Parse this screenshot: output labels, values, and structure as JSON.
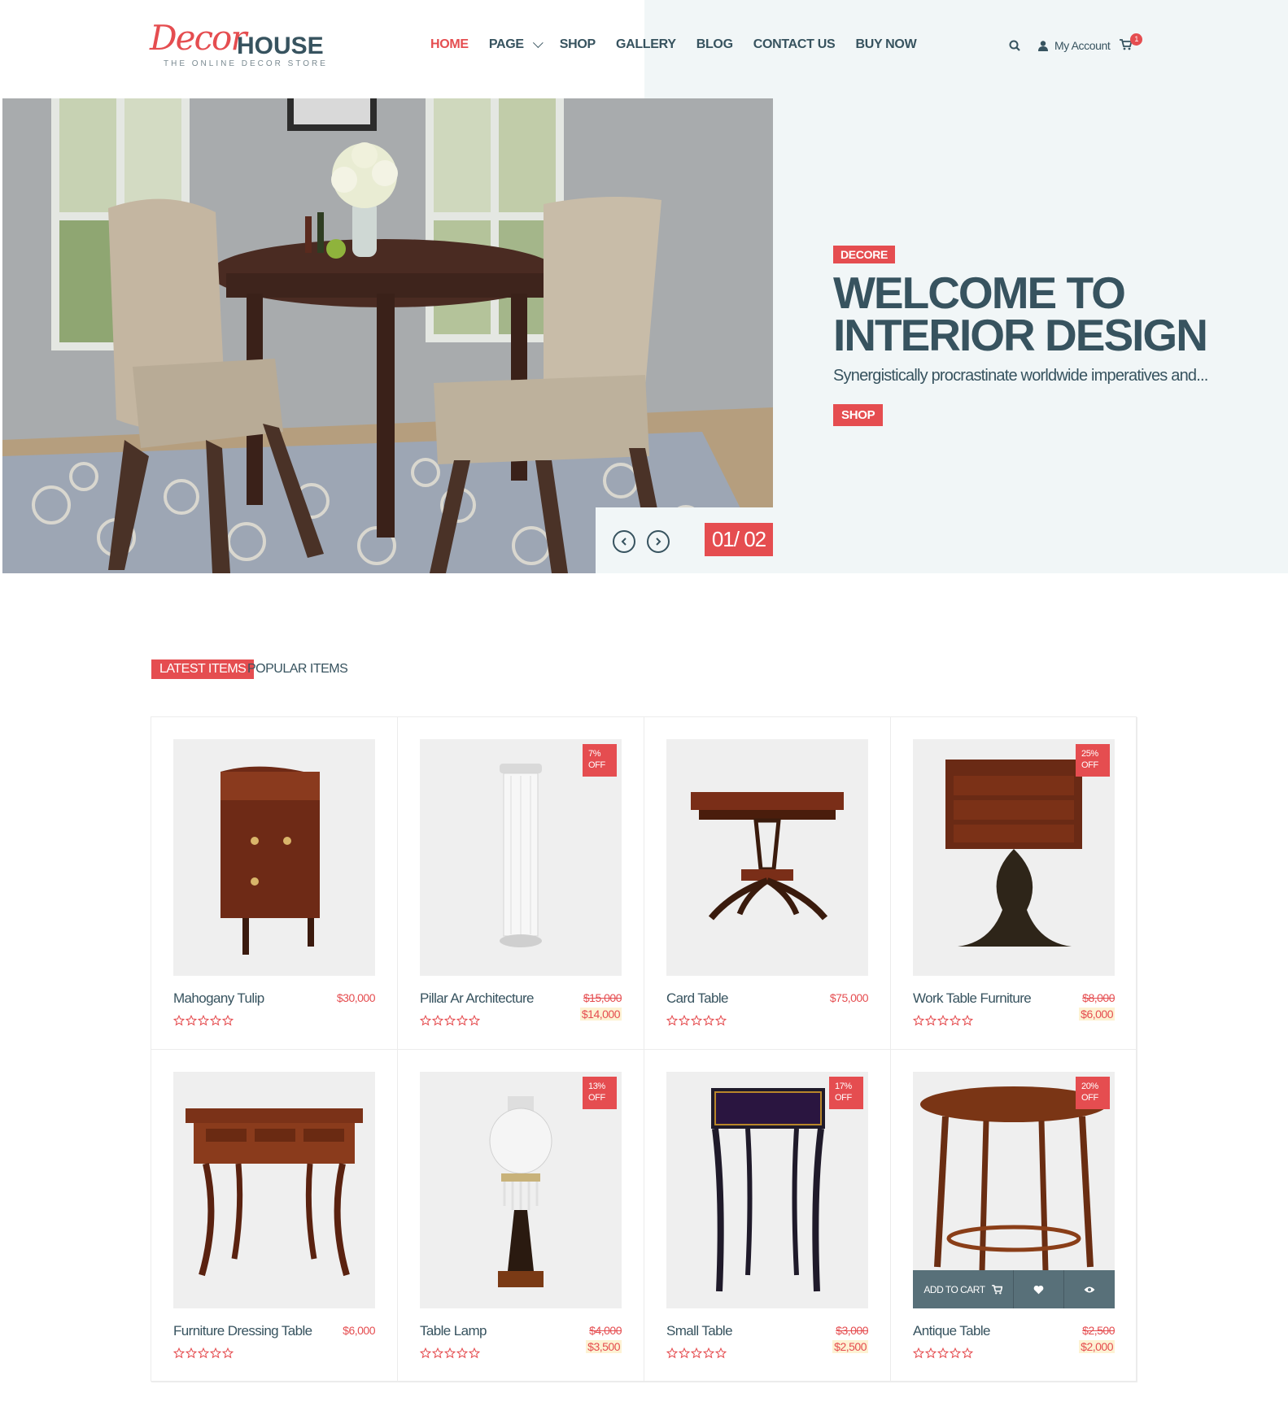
{
  "brand": {
    "logo_script": "Decor",
    "logo_main": "HOUSE",
    "tagline": "THE ONLINE DECOR STORE"
  },
  "nav": [
    {
      "label": "HOME",
      "active": true
    },
    {
      "label": "PAGE",
      "dropdown": true
    },
    {
      "label": "SHOP"
    },
    {
      "label": "GALLERY"
    },
    {
      "label": "BLOG"
    },
    {
      "label": "CONTACT US"
    },
    {
      "label": "BUY NOW"
    }
  ],
  "header_tools": {
    "account_label": "My Account",
    "cart_count": "1",
    "icons": [
      "search-icon",
      "user-icon",
      "cart-icon"
    ]
  },
  "hero": {
    "tag": "DECORE",
    "title": "WELCOME TO INTERIOR DESIGN",
    "subtitle": "Synergistically procrastinate worldwide imperatives and...",
    "button": "SHOP",
    "counter": "01/ 02"
  },
  "tabs": [
    {
      "label": "LATEST ITEMS",
      "active": true
    },
    {
      "label": "POPULAR ITEMS",
      "active": false
    }
  ],
  "products": [
    {
      "name": "Mahogany Tulip",
      "price": "$30,000",
      "old_price": null,
      "badge": null
    },
    {
      "name": "Pillar Ar Architecture",
      "price": "$14,000",
      "old_price": "$15,000",
      "badge": [
        "7%",
        "OFF"
      ]
    },
    {
      "name": "Card Table",
      "price": "$75,000",
      "old_price": null,
      "badge": null
    },
    {
      "name": "Work Table Furniture",
      "price": "$6,000",
      "old_price": "$8,000",
      "badge": [
        "25%",
        "OFF"
      ]
    },
    {
      "name": "Furniture Dressing Table",
      "price": "$6,000",
      "old_price": null,
      "badge": null
    },
    {
      "name": "Table Lamp",
      "price": "$3,500",
      "old_price": "$4,000",
      "badge": [
        "13%",
        "OFF"
      ]
    },
    {
      "name": "Small Table",
      "price": "$2,500",
      "old_price": "$3,000",
      "badge": [
        "17%",
        "OFF"
      ]
    },
    {
      "name": "Antique Table",
      "price": "$2,000",
      "old_price": "$2,500",
      "badge": [
        "20%",
        "OFF"
      ],
      "hover_bar": {
        "add_label": "ADD TO CART"
      }
    }
  ],
  "colors": {
    "accent": "#e54d50",
    "dark": "#37535f",
    "hero_panel": "#f1f6f7",
    "sale_highlight": "#fdf2d3"
  }
}
